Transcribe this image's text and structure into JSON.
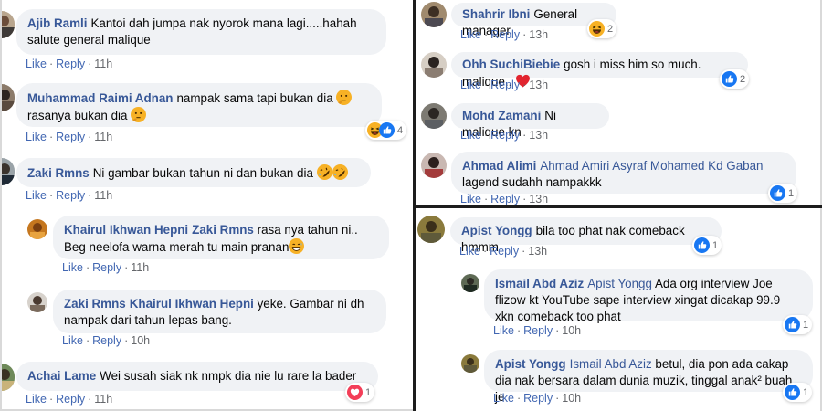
{
  "left": {
    "comments": [
      {
        "name": "Ajib Ramli",
        "text": "Kantoi dah jumpa nak nyorok mana lagi.....hahah salute general malique",
        "like": "Like",
        "reply": "Reply",
        "time": "11h"
      },
      {
        "name": "Muhammad Raimi Adnan",
        "text": "nampak sama tapi bukan dia",
        "text2": "rasanya bukan dia",
        "like": "Like",
        "reply": "Reply",
        "time": "11h",
        "reaction_count": "4"
      },
      {
        "name": "Zaki Rmns",
        "text": "Ni gambar bukan tahun ni dan bukan dia",
        "like": "Like",
        "reply": "Reply",
        "time": "11h"
      },
      {
        "name": "Khairul Ikhwan Hepni",
        "tag": "Zaki Rmns",
        "text": "rasa nya tahun ni.. Beg neelofa warna merah tu main pranan",
        "like": "Like",
        "reply": "Reply",
        "time": "11h"
      },
      {
        "name": "Zaki Rmns",
        "tag": "Khairul Ikhwan Hepni",
        "text": "yeke. Gambar ni dh nampak dari tahun lepas bang.",
        "like": "Like",
        "reply": "Reply",
        "time": "10h"
      },
      {
        "name": "Achai Lame",
        "text": "Wei susah siak nk nmpk dia nie lu rare la bader",
        "like": "Like",
        "reply": "Reply",
        "time": "11h",
        "reaction_count": "1"
      }
    ]
  },
  "right_top": {
    "comments": [
      {
        "name": "Shahrir Ibni",
        "text": "General manager",
        "like": "Like",
        "reply": "Reply",
        "time": "13h",
        "reaction_count": "2"
      },
      {
        "name": "Ohh SuchiBiebie",
        "text": "gosh i miss him so much. malique..",
        "like": "Like",
        "reply": "Reply",
        "time": "13h",
        "reaction_count": "2"
      },
      {
        "name": "Mohd Zamani",
        "text": "Ni malique kn",
        "like": "Like",
        "reply": "Reply",
        "time": "13h"
      },
      {
        "name": "Ahmad Alimi",
        "tag": "Ahmad Amiri Asyraf Mohamed Kd Gaban",
        "text": "lagend sudahh nampakkk",
        "like": "Like",
        "reply": "Reply",
        "time": "13h",
        "reaction_count": "1"
      }
    ]
  },
  "right_bottom": {
    "comments": [
      {
        "name": "Apist Yongg",
        "text": "bila too phat nak comeback hmmm",
        "like": "Like",
        "reply": "Reply",
        "time": "13h",
        "reaction_count": "1"
      },
      {
        "name": "Ismail Abd Aziz",
        "tag": "Apist Yongg",
        "text": "Ada org interview Joe flizow kt YouTube sape interview xingat dicakap 99.9 xkn comeback too phat",
        "like": "Like",
        "reply": "Reply",
        "time": "10h",
        "reaction_count": "1"
      },
      {
        "name": "Apist Yongg",
        "tag": "Ismail Abd Aziz",
        "text": "betul, dia pon ada cakap dia nak bersara dalam dunia muzik, tinggal anak² buah je",
        "like": "Like",
        "reply": "Reply",
        "time": "10h",
        "reaction_count": "1"
      }
    ]
  },
  "colors": {
    "name": "#385898",
    "action": "#4267b2",
    "bubble": "#f0f2f5",
    "like_blue": "#1877f2",
    "love_red": "#f33e58",
    "haha_yellow": "#f7b125"
  }
}
